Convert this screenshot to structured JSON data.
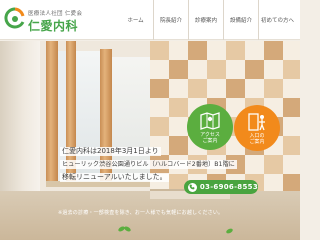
{
  "header": {
    "org_name": "医療法人社団 仁愛会",
    "clinic_name": "仁愛内科"
  },
  "nav": {
    "items": [
      {
        "label": "ホーム"
      },
      {
        "label": "院長紹介"
      },
      {
        "label": "診療案内"
      },
      {
        "label": "設備紹介"
      },
      {
        "label": "初めての方へ"
      }
    ]
  },
  "hero": {
    "line1": "仁愛内科は2018年3月1日より",
    "line2": "ヒューリック渋谷公園通りビル（ハルコバード2番地）B1階に",
    "line3": "移転リニューアルいたしました。",
    "phone": "03-6906-8553",
    "note": "※過去の診療・一部検査を除き、お一人様でも気軽にお越しください。",
    "access_label": "アクセス\nご案内",
    "entry_label": "入口の\nご案内"
  },
  "colors": {
    "brand_green": "#46a54a",
    "access_bubble": "#5bae3f",
    "entry_bubble": "#f28a1b"
  },
  "icons": {
    "logo": "clinic-logo-mark",
    "access": "map-icon",
    "entry": "door-person-icon",
    "phone": "phone-icon"
  }
}
